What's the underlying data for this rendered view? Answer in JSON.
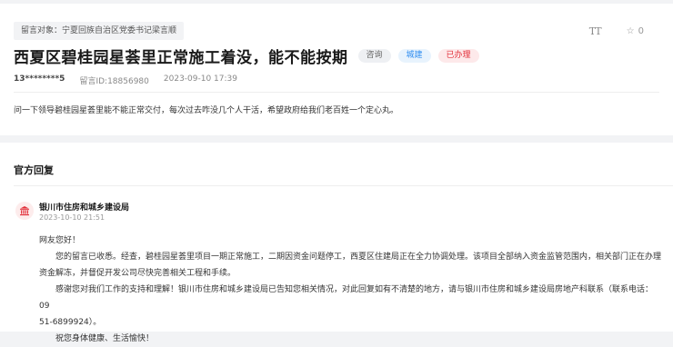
{
  "message": {
    "recipient": "留言对象：宁夏回族自治区党委书记梁言顺",
    "title": "西夏区碧桂园星荟里正常施工着没，能不能按期",
    "tags": [
      "咨询",
      "城建",
      "已办理"
    ],
    "author": "13********5",
    "id_text": "留言ID:18856980",
    "datetime": "2023-09-10 17:39",
    "content": "问一下领导碧桂园星荟里能不能正常交付，每次过去咋没几个人干活，希望政府给我们老百姓一个定心丸。",
    "font_tool_label": "TT",
    "favorite_count": "0"
  },
  "reply": {
    "section_title": "官方回复",
    "department": "银川市住房和城乡建设局",
    "datetime": "2023-10-10 21:51",
    "greeting": "网友您好！",
    "para1_line1": "您的留言已收悉。经查，碧桂园星荟里项目一期正常施工，二期因资金问题停工，西夏区住建局正在全力协调处理。该项目全部纳入资金监管范围内，相关部门正在办理",
    "para1_line2": "资金解冻，并督促开发公司尽快完善相关工程和手续。",
    "para2_line1": "感谢您对我们工作的支持和理解！银川市住房和城乡建设局已告知您相关情况，对此回复如有不清楚的地方，请与银川市住房和城乡建设局房地产科联系（联系电话：09",
    "para2_line2": "51-6899924）。",
    "closing": "祝您身体健康、生活愉快！"
  },
  "colors": {
    "accent_blue": "#2d8cf0",
    "status_red": "#e2313b",
    "background": "#f2f3f5"
  },
  "icons": {
    "font_size_tool": "font-size-icon",
    "favorite": "star-icon",
    "department": "government-building-icon"
  }
}
